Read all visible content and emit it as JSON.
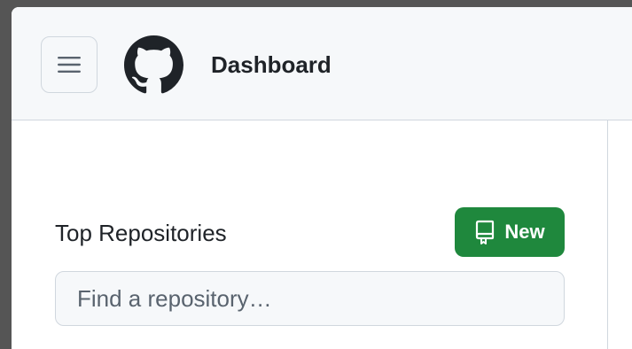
{
  "header": {
    "title": "Dashboard",
    "menu_icon": "hamburger-icon",
    "logo_icon": "github-logo-icon"
  },
  "repositories": {
    "section_title": "Top Repositories",
    "new_button_label": "New",
    "new_button_icon": "repo-icon",
    "search": {
      "placeholder": "Find a repository…",
      "value": ""
    }
  },
  "colors": {
    "accent_green": "#1f883d",
    "header_bg": "#f6f8fa",
    "border": "#d0d7de",
    "text": "#1f2328"
  }
}
